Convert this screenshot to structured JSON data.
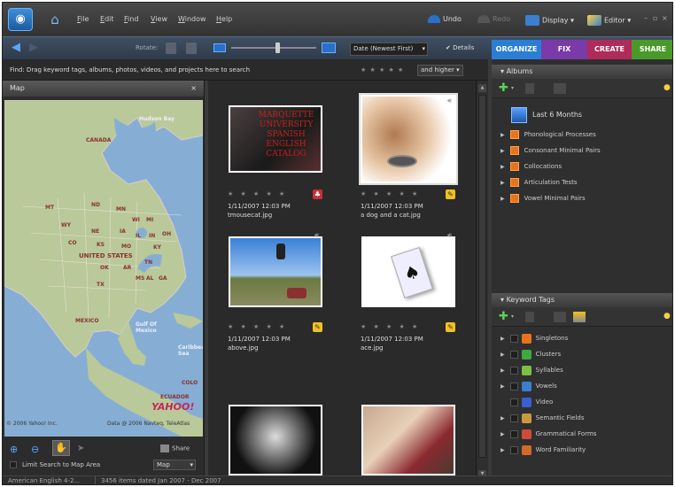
{
  "menubar": {
    "menus": [
      "File",
      "Edit",
      "Find",
      "View",
      "Window",
      "Help"
    ],
    "undo": "Undo",
    "redo": "Redo",
    "display": "Display",
    "editor": "Editor"
  },
  "toolbar": {
    "rotate_label": "Rotate:",
    "sort": "Date (Newest First)",
    "details": "Details",
    "tabs": {
      "organize": "ORGANIZE",
      "fix": "FIX",
      "create": "CREATE",
      "share": "SHARE"
    }
  },
  "findbar": {
    "text": "Find: Drag keyword tags, albums, photos, videos, and projects here to search",
    "stars": "★ ★ ★ ★ ★",
    "and_higher": "and higher"
  },
  "map": {
    "title": "Map",
    "labels": [
      "Hudson Bay",
      "CANADA",
      "MT",
      "ND",
      "MN",
      "WI",
      "MI",
      "WY",
      "NE",
      "IA",
      "IL",
      "IN",
      "OH",
      "CO",
      "KS",
      "MO",
      "KY",
      "UNITED STATES",
      "OK",
      "AR",
      "TN",
      "TX",
      "MS",
      "AL",
      "GA",
      "MEXICO",
      "Gulf Of Mexico",
      "Caribbean Sea",
      "ECUADOR",
      "COLO"
    ],
    "copyright_left": "© 2006 Yahoo! Inc.",
    "copyright_right": "Data @ 2006 Navteq, TeleAtlas",
    "brand": "YAHOO!",
    "share": "Share",
    "limit_search": "Limit Search to Map Area",
    "map_type": "Map"
  },
  "grid": {
    "items": [
      {
        "date": "1/11/2007 12:03 PM",
        "name": "tmousecat.jpg",
        "stars": "★ ★ ★ ★ ★",
        "overlay": "MARQUETTE UNIVERSITY SPANISH ENGLISH CATALOG"
      },
      {
        "date": "1/11/2007 12:03 PM",
        "name": "a dog and a cat.jpg",
        "stars": "★ ★ ★ ★ ★"
      },
      {
        "date": "1/11/2007 12:03 PM",
        "name": "above.jpg",
        "stars": "★ ★ ★ ★ ★"
      },
      {
        "date": "1/11/2007 12:03 PM",
        "name": "ace.jpg",
        "stars": "★ ★ ★ ★ ★"
      },
      {
        "date": "",
        "name": "",
        "stars": ""
      },
      {
        "date": "",
        "name": "",
        "stars": ""
      }
    ]
  },
  "albums": {
    "title": "Albums",
    "smart": "Last 6 Months",
    "items": [
      "Phonological Processes",
      "Consonant Minimal Pairs",
      "Collocations",
      "Articulation Tests",
      "Vowel Minimal Pairs"
    ]
  },
  "keywords": {
    "title": "Keyword Tags",
    "items": [
      {
        "label": "Singletons",
        "color": "#e8731f"
      },
      {
        "label": "Clusters",
        "color": "#3fa83f"
      },
      {
        "label": "Syllables",
        "color": "#7bc043"
      },
      {
        "label": "Vowels",
        "color": "#3a7fd0"
      },
      {
        "label": "Video",
        "color": "#3a5fd0"
      },
      {
        "label": "Semantic Fields",
        "color": "#c89a40"
      },
      {
        "label": "Grammatical Forms",
        "color": "#d04a3a"
      },
      {
        "label": "Word Familiarity",
        "color": "#d06a2a"
      }
    ]
  },
  "status": {
    "language": "American English 4-2...",
    "items": "3456 items dated Jan 2007 - Dec 2007"
  }
}
